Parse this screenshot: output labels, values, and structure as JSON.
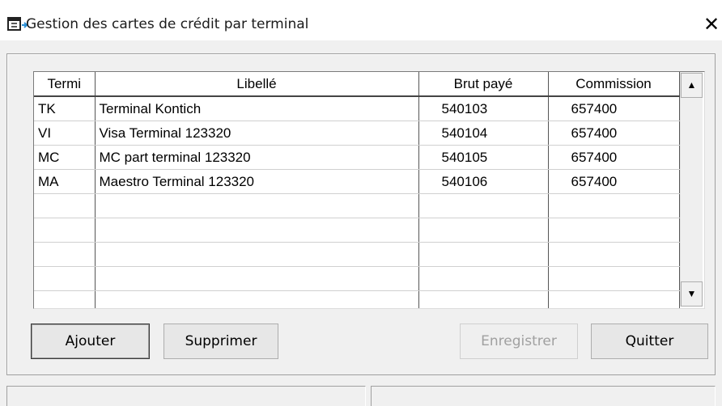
{
  "window": {
    "title": "Gestion des cartes de crédit par terminal",
    "close_label": "✕",
    "icon": "window-app-icon"
  },
  "grid": {
    "columns": [
      "Termi",
      "Libellé",
      "Brut payé",
      "Commission"
    ],
    "rows": [
      {
        "code": "TK",
        "label": "Terminal Kontich",
        "brut": "540103",
        "commission": "657400"
      },
      {
        "code": "VI",
        "label": "Visa Terminal 123320",
        "brut": "540104",
        "commission": "657400"
      },
      {
        "code": "MC",
        "label": "MC part terminal 123320",
        "brut": "540105",
        "commission": "657400"
      },
      {
        "code": "MA",
        "label": "Maestro Terminal 123320",
        "brut": "540106",
        "commission": "657400"
      },
      {
        "code": "",
        "label": "",
        "brut": "",
        "commission": ""
      },
      {
        "code": "",
        "label": "",
        "brut": "",
        "commission": ""
      },
      {
        "code": "",
        "label": "",
        "brut": "",
        "commission": ""
      },
      {
        "code": "",
        "label": "",
        "brut": "",
        "commission": ""
      },
      {
        "code": "",
        "label": "",
        "brut": "",
        "commission": ""
      }
    ],
    "scroll_up": "▲",
    "scroll_down": "▼"
  },
  "buttons": {
    "add": "Ajouter",
    "delete": "Supprimer",
    "save": "Enregistrer",
    "quit": "Quitter"
  }
}
